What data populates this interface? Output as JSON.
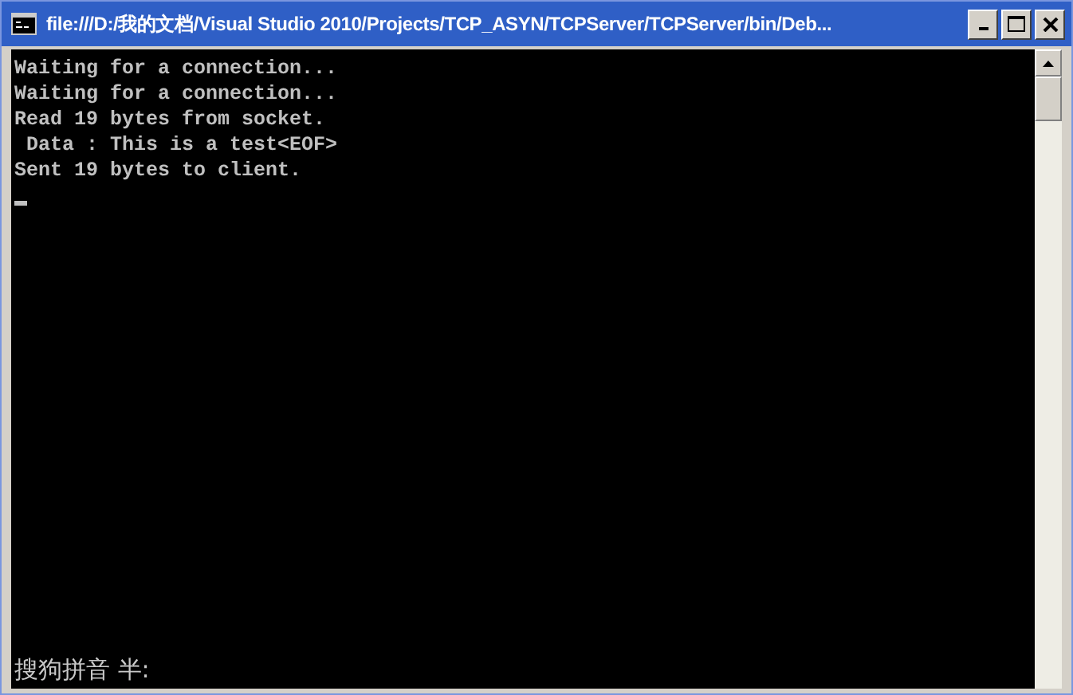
{
  "window": {
    "title": "file:///D:/我的文档/Visual Studio 2010/Projects/TCP_ASYN/TCPServer/TCPServer/bin/Deb..."
  },
  "console": {
    "lines": [
      "Waiting for a connection...",
      "Waiting for a connection...",
      "Read 19 bytes from socket.",
      " Data : This is a test<EOF>",
      "Sent 19 bytes to client."
    ]
  },
  "ime_status": "搜狗拼音 半:"
}
